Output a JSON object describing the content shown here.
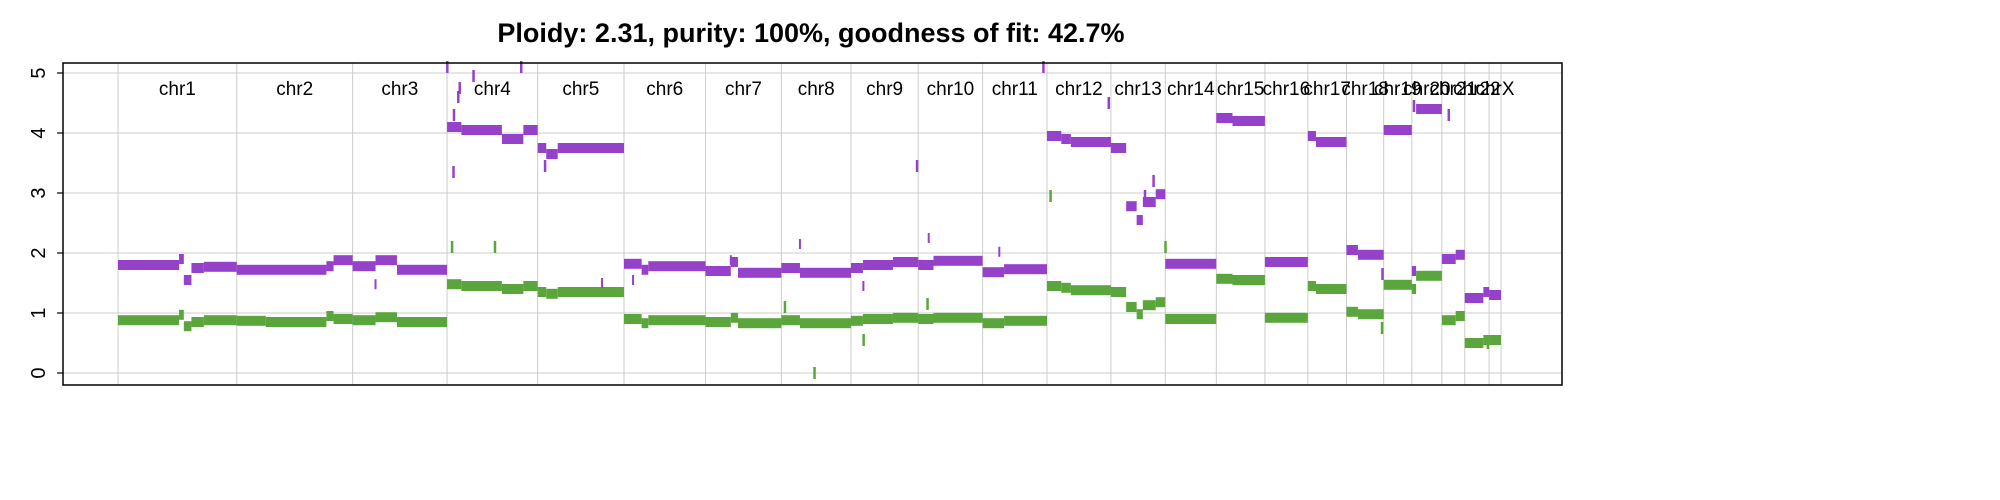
{
  "chart_data": {
    "type": "scatter",
    "title": "Ploidy: 2.31, purity: 100%, goodness of fit: 42.7%",
    "xlabel": "",
    "ylabel": "",
    "ylim": [
      0,
      5
    ],
    "yticks": [
      "0",
      "1",
      "2",
      "3",
      "4",
      "5"
    ],
    "grid": true,
    "colors": {
      "major": "#9541c9",
      "minor": "#5aa63c",
      "grid": "#cccccc"
    },
    "chromosomes": [
      {
        "name": "chr1",
        "start": 0,
        "end": 249
      },
      {
        "name": "chr2",
        "start": 249,
        "end": 492
      },
      {
        "name": "chr3",
        "start": 492,
        "end": 690
      },
      {
        "name": "chr4",
        "start": 690,
        "end": 880
      },
      {
        "name": "chr5",
        "start": 880,
        "end": 1061
      },
      {
        "name": "chr6",
        "start": 1061,
        "end": 1232
      },
      {
        "name": "chr7",
        "start": 1232,
        "end": 1391
      },
      {
        "name": "chr8",
        "start": 1391,
        "end": 1537
      },
      {
        "name": "chr9",
        "start": 1537,
        "end": 1678
      },
      {
        "name": "chr10",
        "start": 1678,
        "end": 1813
      },
      {
        "name": "chr11",
        "start": 1813,
        "end": 1948
      },
      {
        "name": "chr12",
        "start": 1948,
        "end": 2082
      },
      {
        "name": "chr13",
        "start": 2082,
        "end": 2196
      },
      {
        "name": "chr14",
        "start": 2196,
        "end": 2303
      },
      {
        "name": "chr15",
        "start": 2303,
        "end": 2405
      },
      {
        "name": "chr16",
        "start": 2405,
        "end": 2495
      },
      {
        "name": "chr17",
        "start": 2495,
        "end": 2576
      },
      {
        "name": "chr18",
        "start": 2576,
        "end": 2654
      },
      {
        "name": "chr19",
        "start": 2654,
        "end": 2713
      },
      {
        "name": "chr20",
        "start": 2713,
        "end": 2776
      },
      {
        "name": "chr21",
        "start": 2776,
        "end": 2824
      },
      {
        "name": "chr22",
        "start": 2824,
        "end": 2875
      },
      {
        "name": "chrX",
        "start": 2875,
        "end": 2900
      }
    ],
    "series": [
      {
        "name": "",
        "segments": [
          [
            0,
            128,
            1.8
          ],
          [
            128,
            138,
            1.9
          ],
          [
            138,
            154,
            1.55
          ],
          [
            154,
            180,
            1.75
          ],
          [
            180,
            249,
            1.77
          ],
          [
            249,
            437,
            1.72
          ],
          [
            437,
            452,
            1.78
          ],
          [
            452,
            492,
            1.88
          ],
          [
            492,
            540,
            1.78
          ],
          [
            540,
            585,
            1.88
          ],
          [
            585,
            690,
            1.72
          ],
          [
            690,
            720,
            4.1
          ],
          [
            720,
            805,
            4.05
          ],
          [
            805,
            850,
            3.9
          ],
          [
            850,
            880,
            4.05
          ],
          [
            880,
            898,
            3.75
          ],
          [
            898,
            922,
            3.65
          ],
          [
            922,
            1061,
            3.75
          ],
          [
            1061,
            1098,
            1.82
          ],
          [
            1098,
            1112,
            1.72
          ],
          [
            1112,
            1232,
            1.78
          ],
          [
            1232,
            1285,
            1.7
          ],
          [
            1285,
            1300,
            1.85
          ],
          [
            1300,
            1391,
            1.67
          ],
          [
            1391,
            1430,
            1.75
          ],
          [
            1430,
            1537,
            1.67
          ],
          [
            1537,
            1562,
            1.75
          ],
          [
            1562,
            1625,
            1.8
          ],
          [
            1625,
            1678,
            1.85
          ],
          [
            1678,
            1710,
            1.8
          ],
          [
            1710,
            1813,
            1.87
          ],
          [
            1813,
            1858,
            1.68
          ],
          [
            1858,
            1948,
            1.73
          ],
          [
            1948,
            1978,
            3.95
          ],
          [
            1978,
            1998,
            3.9
          ],
          [
            1998,
            2082,
            3.85
          ],
          [
            2082,
            2114,
            3.75
          ],
          [
            2114,
            2136,
            2.78
          ],
          [
            2136,
            2149,
            2.55
          ],
          [
            2149,
            2176,
            2.85
          ],
          [
            2176,
            2196,
            2.98
          ],
          [
            2196,
            2303,
            1.82
          ],
          [
            2303,
            2337,
            4.25
          ],
          [
            2337,
            2405,
            4.2
          ],
          [
            2405,
            2495,
            1.85
          ],
          [
            2495,
            2512,
            3.95
          ],
          [
            2512,
            2576,
            3.85
          ],
          [
            2576,
            2600,
            2.05
          ],
          [
            2600,
            2654,
            1.97
          ],
          [
            2654,
            2713,
            4.05
          ],
          [
            2713,
            2722,
            1.7
          ],
          [
            2722,
            2776,
            4.4
          ],
          [
            2776,
            2805,
            1.9
          ],
          [
            2805,
            2824,
            1.97
          ],
          [
            2824,
            2863,
            1.25
          ],
          [
            2863,
            2875,
            1.35
          ],
          [
            2875,
            2900,
            1.3
          ]
        ]
      },
      {
        "name": "",
        "segments": [
          [
            0,
            128,
            0.88
          ],
          [
            128,
            138,
            0.97
          ],
          [
            138,
            154,
            0.78
          ],
          [
            154,
            180,
            0.85
          ],
          [
            180,
            249,
            0.88
          ],
          [
            249,
            310,
            0.87
          ],
          [
            310,
            437,
            0.85
          ],
          [
            437,
            452,
            0.95
          ],
          [
            452,
            492,
            0.9
          ],
          [
            492,
            540,
            0.88
          ],
          [
            540,
            585,
            0.93
          ],
          [
            585,
            690,
            0.85
          ],
          [
            690,
            720,
            1.48
          ],
          [
            720,
            805,
            1.45
          ],
          [
            805,
            850,
            1.4
          ],
          [
            850,
            880,
            1.45
          ],
          [
            880,
            898,
            1.35
          ],
          [
            898,
            922,
            1.32
          ],
          [
            922,
            1061,
            1.35
          ],
          [
            1061,
            1098,
            0.9
          ],
          [
            1098,
            1112,
            0.83
          ],
          [
            1112,
            1232,
            0.88
          ],
          [
            1232,
            1285,
            0.85
          ],
          [
            1285,
            1300,
            0.92
          ],
          [
            1300,
            1391,
            0.83
          ],
          [
            1391,
            1430,
            0.88
          ],
          [
            1430,
            1537,
            0.83
          ],
          [
            1537,
            1562,
            0.87
          ],
          [
            1562,
            1625,
            0.9
          ],
          [
            1625,
            1678,
            0.92
          ],
          [
            1678,
            1710,
            0.9
          ],
          [
            1710,
            1813,
            0.92
          ],
          [
            1813,
            1858,
            0.83
          ],
          [
            1858,
            1948,
            0.87
          ],
          [
            1948,
            1978,
            1.45
          ],
          [
            1978,
            1998,
            1.42
          ],
          [
            1998,
            2082,
            1.38
          ],
          [
            2082,
            2114,
            1.35
          ],
          [
            2114,
            2136,
            1.1
          ],
          [
            2136,
            2149,
            0.98
          ],
          [
            2149,
            2176,
            1.13
          ],
          [
            2176,
            2196,
            1.18
          ],
          [
            2196,
            2303,
            0.9
          ],
          [
            2303,
            2337,
            1.57
          ],
          [
            2337,
            2405,
            1.55
          ],
          [
            2405,
            2495,
            0.92
          ],
          [
            2495,
            2512,
            1.45
          ],
          [
            2512,
            2576,
            1.4
          ],
          [
            2576,
            2600,
            1.02
          ],
          [
            2600,
            2654,
            0.98
          ],
          [
            2654,
            2713,
            1.47
          ],
          [
            2713,
            2722,
            1.4
          ],
          [
            2722,
            2776,
            1.62
          ],
          [
            2776,
            2805,
            0.88
          ],
          [
            2805,
            2824,
            0.95
          ],
          [
            2824,
            2863,
            0.5
          ],
          [
            2863,
            2875,
            0.55
          ],
          [
            2875,
            2900,
            0.55
          ]
        ]
      }
    ],
    "outliers_major": [
      [
        703,
        3.35
      ],
      [
        704,
        4.3
      ],
      [
        713,
        4.6
      ],
      [
        716,
        4.75
      ],
      [
        745,
        4.95
      ],
      [
        845,
        5.1
      ],
      [
        690,
        5.1
      ],
      [
        895,
        3.45
      ],
      [
        1940,
        5.1
      ],
      [
        2077,
        4.5
      ],
      [
        1675,
        3.45
      ],
      [
        2153,
        2.95
      ],
      [
        2171,
        3.2
      ],
      [
        2717,
        4.45
      ],
      [
        2790,
        4.3
      ],
      [
        2651,
        1.65
      ]
    ],
    "outliers_minor": [
      [
        700,
        2.1
      ],
      [
        790,
        2.1
      ],
      [
        1955,
        2.95
      ],
      [
        1460,
        0.0
      ],
      [
        1398,
        1.1
      ],
      [
        2196,
        2.1
      ],
      [
        1563,
        0.55
      ],
      [
        1697,
        1.15
      ],
      [
        2650,
        0.75
      ],
      [
        2872,
        0.5
      ]
    ],
    "outliers_major_dash": [
      [
        1430,
        2.15
      ],
      [
        1700,
        2.25
      ],
      [
        1848,
        2.02
      ],
      [
        1563,
        1.45
      ],
      [
        1015,
        1.5
      ],
      [
        1285,
        1.88
      ],
      [
        540,
        1.48
      ],
      [
        1080,
        1.55
      ]
    ]
  }
}
